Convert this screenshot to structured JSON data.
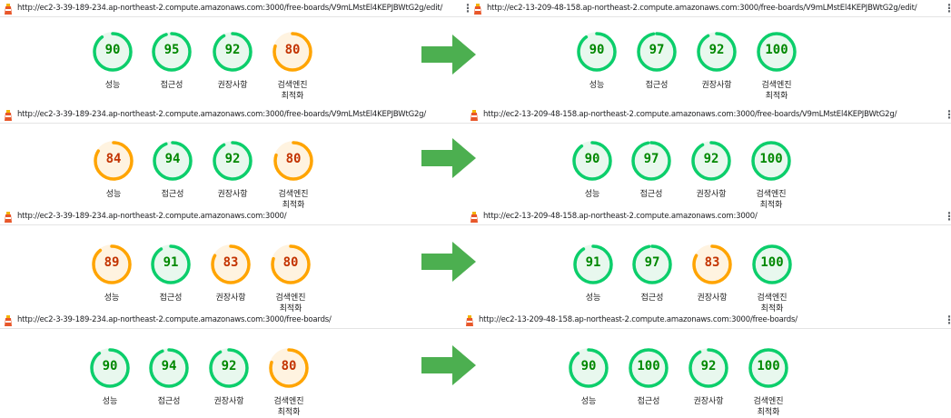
{
  "categories": [
    "성능",
    "접근성",
    "권장사항",
    "검색엔진\n최적화"
  ],
  "colors": {
    "pass": "#0cce6b",
    "pass_bg": "#e8f8ee",
    "average": "#ffa400",
    "average_bg": "#fff3e0",
    "arrow": "#4caf50"
  },
  "rows": [
    {
      "before": {
        "url": "http://ec2-3-39-189-234.ap-northeast-2.compute.amazonaws.com:3000/free-boards/V9mLMstEl4KEPJBWtG2g/edit/",
        "scores": [
          90,
          95,
          92,
          80
        ]
      },
      "after": {
        "url": "http://ec2-13-209-48-158.ap-northeast-2.compute.amazonaws.com:3000/free-boards/V9mLMstEl4KEPJBWtG2g/edit/",
        "scores": [
          90,
          97,
          92,
          100
        ]
      }
    },
    {
      "before": {
        "url": "http://ec2-3-39-189-234.ap-northeast-2.compute.amazonaws.com:3000/free-boards/V9mLMstEl4KEPJBWtG2g/",
        "scores": [
          84,
          94,
          92,
          80
        ]
      },
      "after": {
        "url": "http://ec2-13-209-48-158.ap-northeast-2.compute.amazonaws.com:3000/free-boards/V9mLMstEl4KEPJBWtG2g/",
        "scores": [
          90,
          97,
          92,
          100
        ]
      }
    },
    {
      "before": {
        "url": "http://ec2-3-39-189-234.ap-northeast-2.compute.amazonaws.com:3000/",
        "scores": [
          89,
          91,
          83,
          80
        ]
      },
      "after": {
        "url": "http://ec2-13-209-48-158.ap-northeast-2.compute.amazonaws.com:3000/",
        "scores": [
          91,
          97,
          83,
          100
        ]
      }
    },
    {
      "before": {
        "url": "http://ec2-3-39-189-234.ap-northeast-2.compute.amazonaws.com:3000/free-boards/",
        "scores": [
          90,
          94,
          92,
          80
        ]
      },
      "after": {
        "url": "http://ec2-13-209-48-158.ap-northeast-2.compute.amazonaws.com:3000/free-boards/",
        "scores": [
          90,
          100,
          92,
          100
        ]
      }
    }
  ]
}
